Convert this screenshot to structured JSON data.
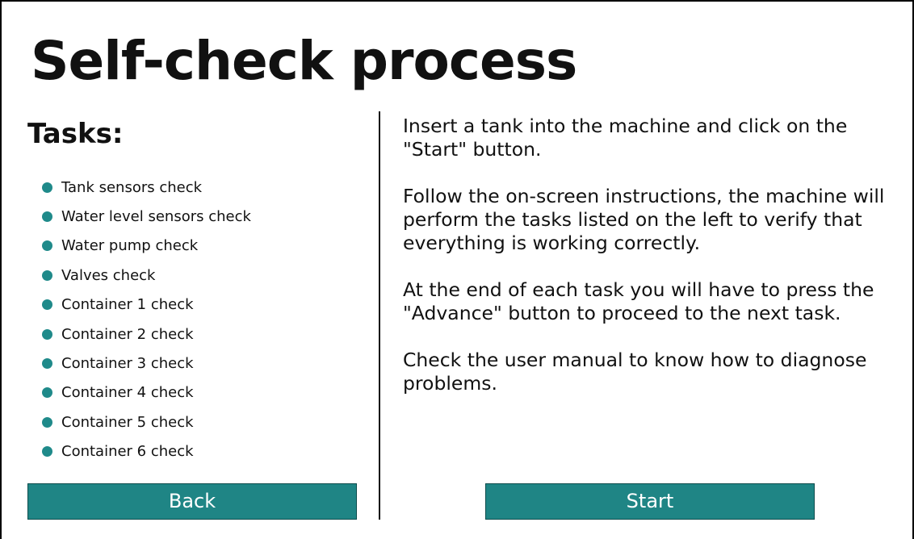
{
  "header": {
    "title": "Self-check process"
  },
  "tasks": {
    "heading": "Tasks:",
    "items": [
      "Tank sensors check",
      "Water level sensors check",
      "Water pump check",
      "Valves check",
      "Container 1 check",
      "Container 2 check",
      "Container 3 check",
      "Container 4 check",
      "Container 5 check",
      "Container 6 check"
    ],
    "bullet_color": "#1f8a8a"
  },
  "instructions": {
    "paragraphs": [
      "Insert a tank into the machine and click on the \"Start\" button.",
      "Follow the on-screen instructions, the machine will perform the tasks listed on the left to verify that everything is working correctly.",
      "At the end of each task you will have to press the \"Advance\" button to proceed to the next task.",
      "Check the user manual to know how to diagnose problems."
    ]
  },
  "buttons": {
    "back_label": "Back",
    "start_label": "Start",
    "color": "#1f8585"
  }
}
